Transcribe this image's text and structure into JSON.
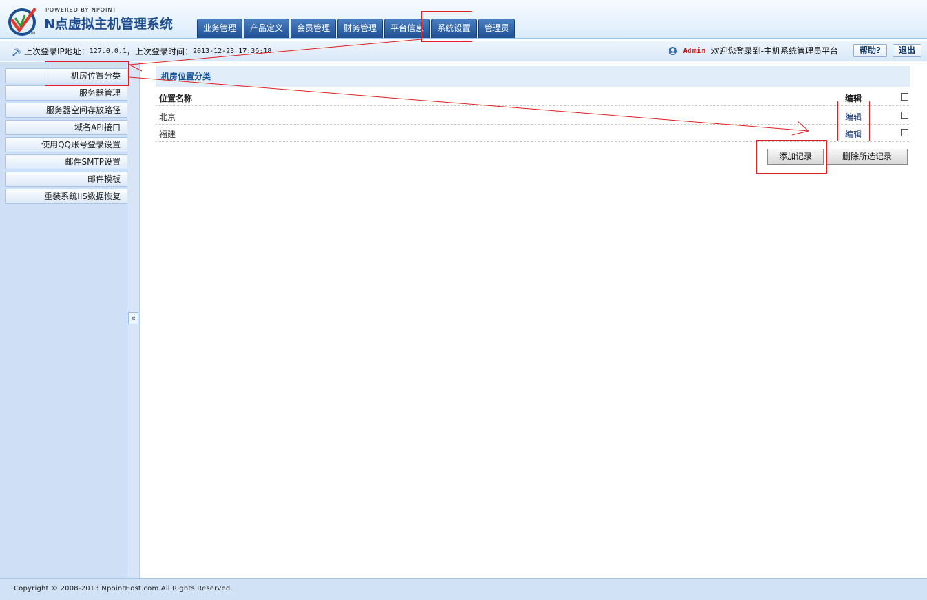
{
  "logo": {
    "powered": "POWERED BY NPOINT",
    "title": "N点虚拟主机管理系统",
    "tm": "TM"
  },
  "nav": {
    "tabs": [
      {
        "label": "业务管理"
      },
      {
        "label": "产品定义"
      },
      {
        "label": "会员管理"
      },
      {
        "label": "财务管理"
      },
      {
        "label": "平台信息"
      },
      {
        "label": "系统设置"
      },
      {
        "label": "管理员"
      }
    ]
  },
  "infobar": {
    "ip_label": "上次登录IP地址：",
    "ip_value": "127.0.0.1",
    "time_label": "，上次登录时间：",
    "time_value": "2013-12-23 17:36:18",
    "admin_name": "Admin",
    "welcome": "欢迎您登录到-主机系统管理员平台",
    "help_label": "帮助?",
    "logout_label": "退出"
  },
  "sidebar": {
    "items": [
      {
        "label": "机房位置分类"
      },
      {
        "label": "服务器管理"
      },
      {
        "label": "服务器空间存放路径"
      },
      {
        "label": "域名API接口"
      },
      {
        "label": "使用QQ账号登录设置"
      },
      {
        "label": "邮件SMTP设置"
      },
      {
        "label": "邮件模板"
      },
      {
        "label": "重装系统IIS数据恢复"
      }
    ],
    "collapse_glyph": "«"
  },
  "content": {
    "section_title": "机房位置分类",
    "table": {
      "headers": {
        "name": "位置名称",
        "edit": "编辑"
      },
      "rows": [
        {
          "name": "北京",
          "edit": "编辑"
        },
        {
          "name": "福建",
          "edit": "编辑"
        }
      ]
    },
    "add_label": "添加记录",
    "delete_label": "删除所选记录"
  },
  "footer": {
    "copyright": "Copyright © 2008-2013 NpointHost.com.All Rights Reserved."
  },
  "colors": {
    "nav_tab": "#2a5ea3",
    "section_title": "#175397",
    "annotation": "#e02020",
    "admin_name": "#d01010"
  }
}
